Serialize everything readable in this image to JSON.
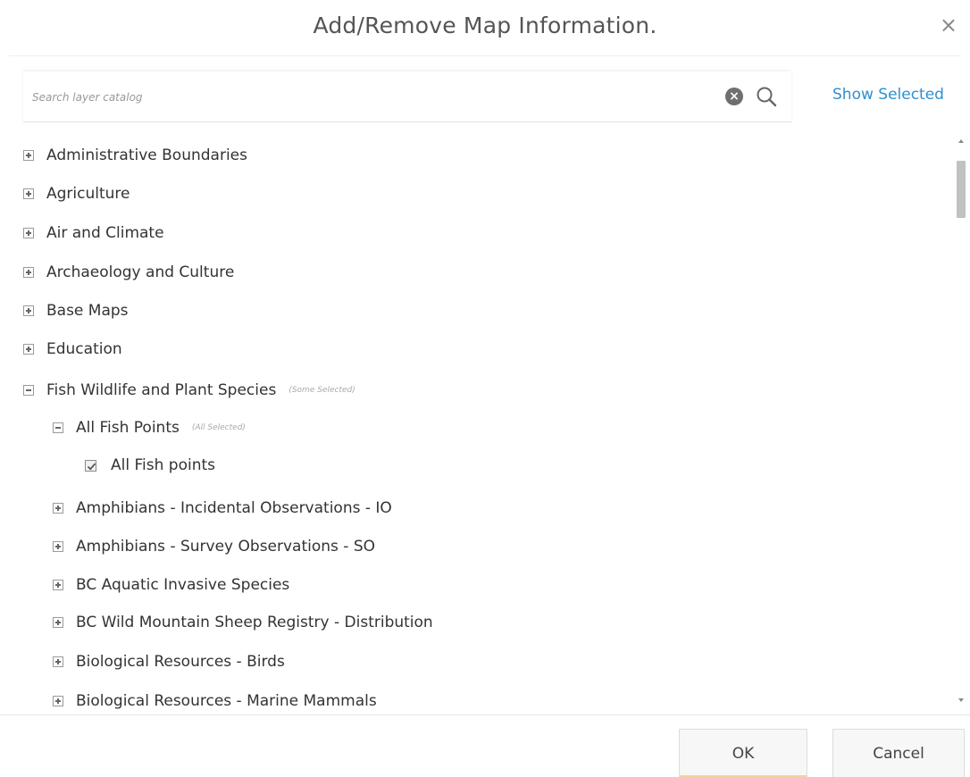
{
  "dialog": {
    "title": "Add/Remove Map Information.",
    "close_symbol": "×"
  },
  "search": {
    "placeholder": "Search layer catalog",
    "value": "",
    "clear_icon": "clear-circle-icon",
    "search_icon": "magnifier-icon",
    "show_selected_label": "Show Selected"
  },
  "tree": {
    "items": [
      {
        "label": "Administrative Boundaries",
        "state": "collapsed",
        "level": 0,
        "note": ""
      },
      {
        "label": "Agriculture",
        "state": "collapsed",
        "level": 0,
        "note": ""
      },
      {
        "label": "Air and Climate",
        "state": "collapsed",
        "level": 0,
        "note": ""
      },
      {
        "label": "Archaeology and Culture",
        "state": "collapsed",
        "level": 0,
        "note": ""
      },
      {
        "label": "Base Maps",
        "state": "collapsed",
        "level": 0,
        "note": ""
      },
      {
        "label": "Education",
        "state": "collapsed",
        "level": 0,
        "note": ""
      },
      {
        "label": "Fish Wildlife and Plant Species",
        "state": "expanded",
        "level": 0,
        "note": "(Some Selected)"
      },
      {
        "label": "All Fish Points",
        "state": "expanded",
        "level": 1,
        "note": "(All Selected)"
      },
      {
        "label": "All Fish points",
        "state": "checked",
        "level": 2,
        "note": ""
      },
      {
        "label": "Amphibians - Incidental Observations - IO",
        "state": "collapsed",
        "level": 1,
        "note": ""
      },
      {
        "label": "Amphibians - Survey Observations - SO",
        "state": "collapsed",
        "level": 1,
        "note": ""
      },
      {
        "label": "BC Aquatic Invasive Species",
        "state": "collapsed",
        "level": 1,
        "note": ""
      },
      {
        "label": "BC Wild Mountain Sheep Registry - Distribution",
        "state": "collapsed",
        "level": 1,
        "note": ""
      },
      {
        "label": "Biological Resources - Birds",
        "state": "collapsed",
        "level": 1,
        "note": ""
      },
      {
        "label": "Biological Resources - Marine Mammals",
        "state": "collapsed",
        "level": 1,
        "note": ""
      }
    ]
  },
  "footer": {
    "ok_label": "OK",
    "cancel_label": "Cancel"
  },
  "colors": {
    "link": "#2f8fcf",
    "text": "#333333",
    "title": "#555555",
    "note": "#aaaaaa"
  }
}
